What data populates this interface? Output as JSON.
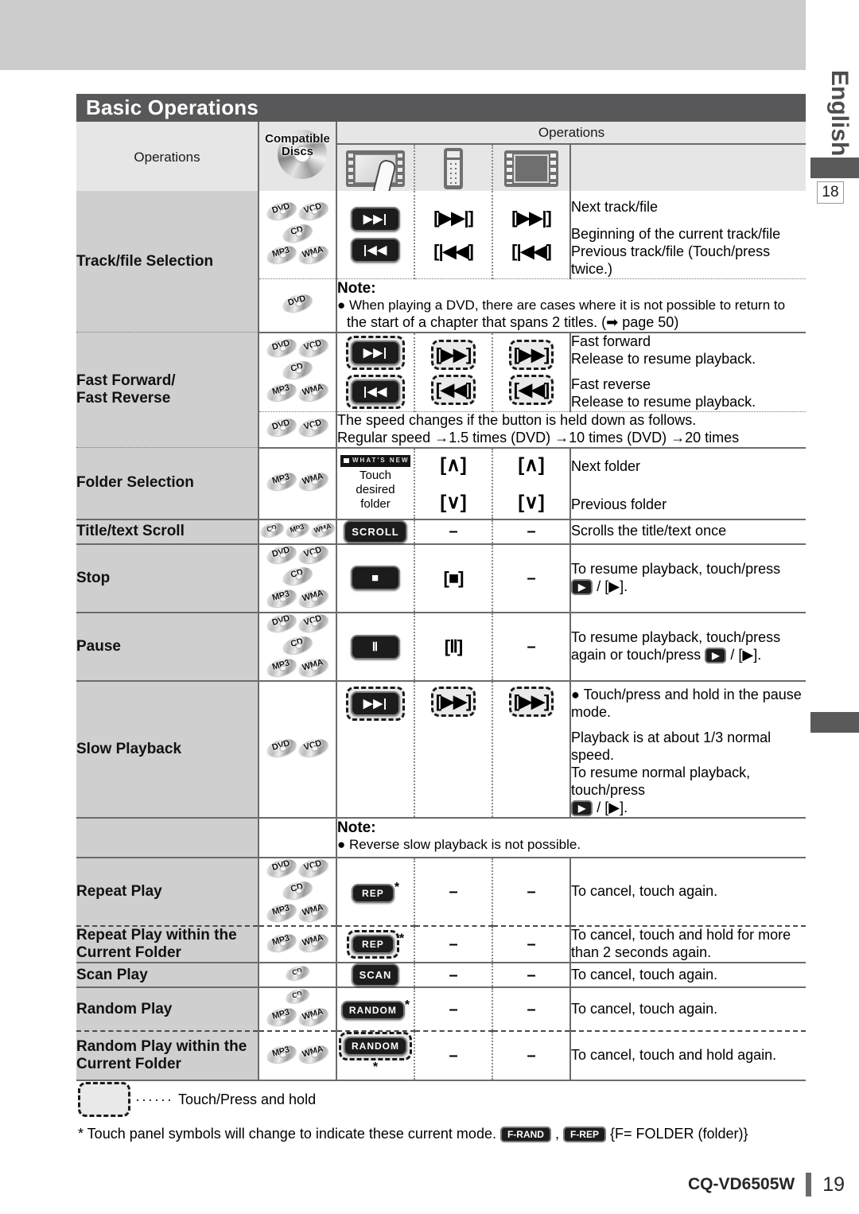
{
  "page": {
    "language_tab": "English",
    "side_page_ref": "18",
    "title": "Basic Operations",
    "model": "CQ-VD6505W",
    "page_number": "19"
  },
  "table": {
    "header": {
      "operations_label": "Operations",
      "compatible_discs_label": "Compatible\nDiscs",
      "compatible_discs_line1": "Compatible",
      "compatible_discs_line2": "Discs",
      "operations_group_label": "Operations",
      "device_icons": [
        "touch-panel-icon",
        "remote-control-icon",
        "display-unit-icon"
      ]
    },
    "rows": [
      {
        "operation": "Track/file Selection",
        "discs": [
          [
            "DVD",
            "VCD"
          ],
          [
            "CD"
          ],
          [
            "MP3",
            "WMA"
          ]
        ],
        "touch_keys": [
          "next-track-key",
          "prev-track-key"
        ],
        "remote_keys": [
          "[▶▶|]",
          "[|◀◀]"
        ],
        "display_keys": [
          "[▶▶|]",
          "[|◀◀]"
        ],
        "descriptions": [
          "Next track/file",
          "Beginning of the current track/file",
          "Previous track/file (Touch/press twice.)"
        ]
      },
      {
        "operation": "",
        "discs": [
          [
            "DVD"
          ]
        ],
        "note_label": "Note:",
        "note_lines": [
          "When playing a DVD, there are cases where it is not possible to return to",
          "the start of a chapter that spans 2 titles. (➡ page 50)"
        ]
      },
      {
        "operation_line1": "Fast Forward/",
        "operation_line2": "Fast Reverse",
        "discs": [
          [
            "DVD",
            "VCD"
          ],
          [
            "CD"
          ],
          [
            "MP3",
            "WMA"
          ]
        ],
        "touch_keys": [
          "fast-forward-key",
          "fast-reverse-key"
        ],
        "remote_keys": [
          "[▶▶]",
          "[◀◀]"
        ],
        "display_keys": [
          "[▶▶]",
          "[◀◀]"
        ],
        "descriptions": [
          "Fast forward",
          "Release to resume playback.",
          "Fast reverse",
          "Release to resume playback."
        ]
      },
      {
        "operation": "",
        "discs": [
          [
            "DVD",
            "VCD"
          ]
        ],
        "speed_lines": [
          "The speed changes if the button is held down as follows.",
          "Regular speed →1.5 times (DVD) →10 times (DVD) →20 times"
        ]
      },
      {
        "operation": "Folder Selection",
        "discs": [
          [
            "MP3",
            "WMA"
          ]
        ],
        "touch_folder_strip_text": "WHAT'S NEW",
        "touch_folder_label": [
          "Touch",
          "desired",
          "folder"
        ],
        "remote_keys": [
          "[∧]",
          "[∨]"
        ],
        "display_keys": [
          "[∧]",
          "[∨]"
        ],
        "descriptions": [
          "Next folder",
          "Previous folder"
        ]
      },
      {
        "operation": "Title/text Scroll",
        "discs": [
          [
            "CD",
            "MP3",
            "WMA"
          ]
        ],
        "touch_key_label": "SCROLL",
        "remote_keys": [
          "–"
        ],
        "display_keys": [
          "–"
        ],
        "descriptions": [
          "Scrolls the title/text once"
        ]
      },
      {
        "operation": "Stop",
        "discs": [
          [
            "DVD",
            "VCD"
          ],
          [
            "CD"
          ],
          [
            "MP3",
            "WMA"
          ]
        ],
        "touch_key_label": "■",
        "remote_keys": [
          "[■]"
        ],
        "display_keys": [
          "–"
        ],
        "descriptions": [
          "To resume playback, touch/press",
          "/ [▶]."
        ]
      },
      {
        "operation": "Pause",
        "discs": [
          [
            "DVD",
            "VCD"
          ],
          [
            "CD"
          ],
          [
            "MP3",
            "WMA"
          ]
        ],
        "touch_key_label": "Ⅱ",
        "remote_keys": [
          "[Ⅱ]"
        ],
        "display_keys": [
          "–"
        ],
        "descriptions": [
          "To resume playback, touch/press",
          "again or touch/press",
          "/ [▶]."
        ]
      },
      {
        "operation": "Slow Playback",
        "discs": [
          [
            "DVD",
            "VCD"
          ]
        ],
        "touch_keys": [
          "slow-playback-key"
        ],
        "remote_keys": [
          "[▶▶]"
        ],
        "display_keys": [
          "[▶▶]"
        ],
        "descriptions": [
          "Touch/press and hold in the pause mode.",
          "Playback is at about 1/3 normal speed.",
          "To resume normal playback, touch/press",
          "/ [▶]."
        ],
        "note_label": "Note:",
        "note_lines": [
          "Reverse slow playback is not possible."
        ]
      },
      {
        "operation": "Repeat Play",
        "discs": [
          [
            "DVD",
            "VCD"
          ],
          [
            "CD"
          ],
          [
            "MP3",
            "WMA"
          ]
        ],
        "touch_key_label": "REP",
        "has_star": true,
        "remote_keys": [
          "–"
        ],
        "display_keys": [
          "–"
        ],
        "descriptions": [
          "To cancel, touch again."
        ]
      },
      {
        "operation_line1": "Repeat Play within the",
        "operation_line2": "Current Folder",
        "discs": [
          [
            "MP3",
            "WMA"
          ]
        ],
        "touch_key_label": "REP",
        "has_star": true,
        "dashed": true,
        "remote_keys": [
          "–"
        ],
        "display_keys": [
          "–"
        ],
        "descriptions": [
          "To cancel, touch and hold for more",
          "than 2 seconds again."
        ]
      },
      {
        "operation": "Scan Play",
        "discs": [
          [
            "CD"
          ]
        ],
        "touch_key_label": "SCAN",
        "remote_keys": [
          "–"
        ],
        "display_keys": [
          "–"
        ],
        "descriptions": [
          "To cancel, touch again."
        ]
      },
      {
        "operation": "Random Play",
        "discs": [
          [
            "CD"
          ],
          [
            "MP3",
            "WMA"
          ]
        ],
        "touch_key_label": "RANDOM",
        "has_star": true,
        "remote_keys": [
          "–"
        ],
        "display_keys": [
          "–"
        ],
        "descriptions": [
          "To cancel, touch again."
        ]
      },
      {
        "operation_line1": "Random Play within the",
        "operation_line2": "Current Folder",
        "discs": [
          [
            "MP3",
            "WMA"
          ]
        ],
        "touch_key_label": "RANDOM",
        "has_star": true,
        "dashed": true,
        "remote_keys": [
          "–"
        ],
        "display_keys": [
          "–"
        ],
        "descriptions": [
          "To cancel, touch and hold again."
        ]
      }
    ]
  },
  "legend": {
    "dots": "······",
    "label": "Touch/Press and hold"
  },
  "footnote": {
    "text_before": "* Touch panel symbols will change to indicate these current mode.",
    "key1": "F-RAND",
    "separator": ",",
    "key2": "F-REP",
    "text_after": "{F= FOLDER (folder)}"
  }
}
